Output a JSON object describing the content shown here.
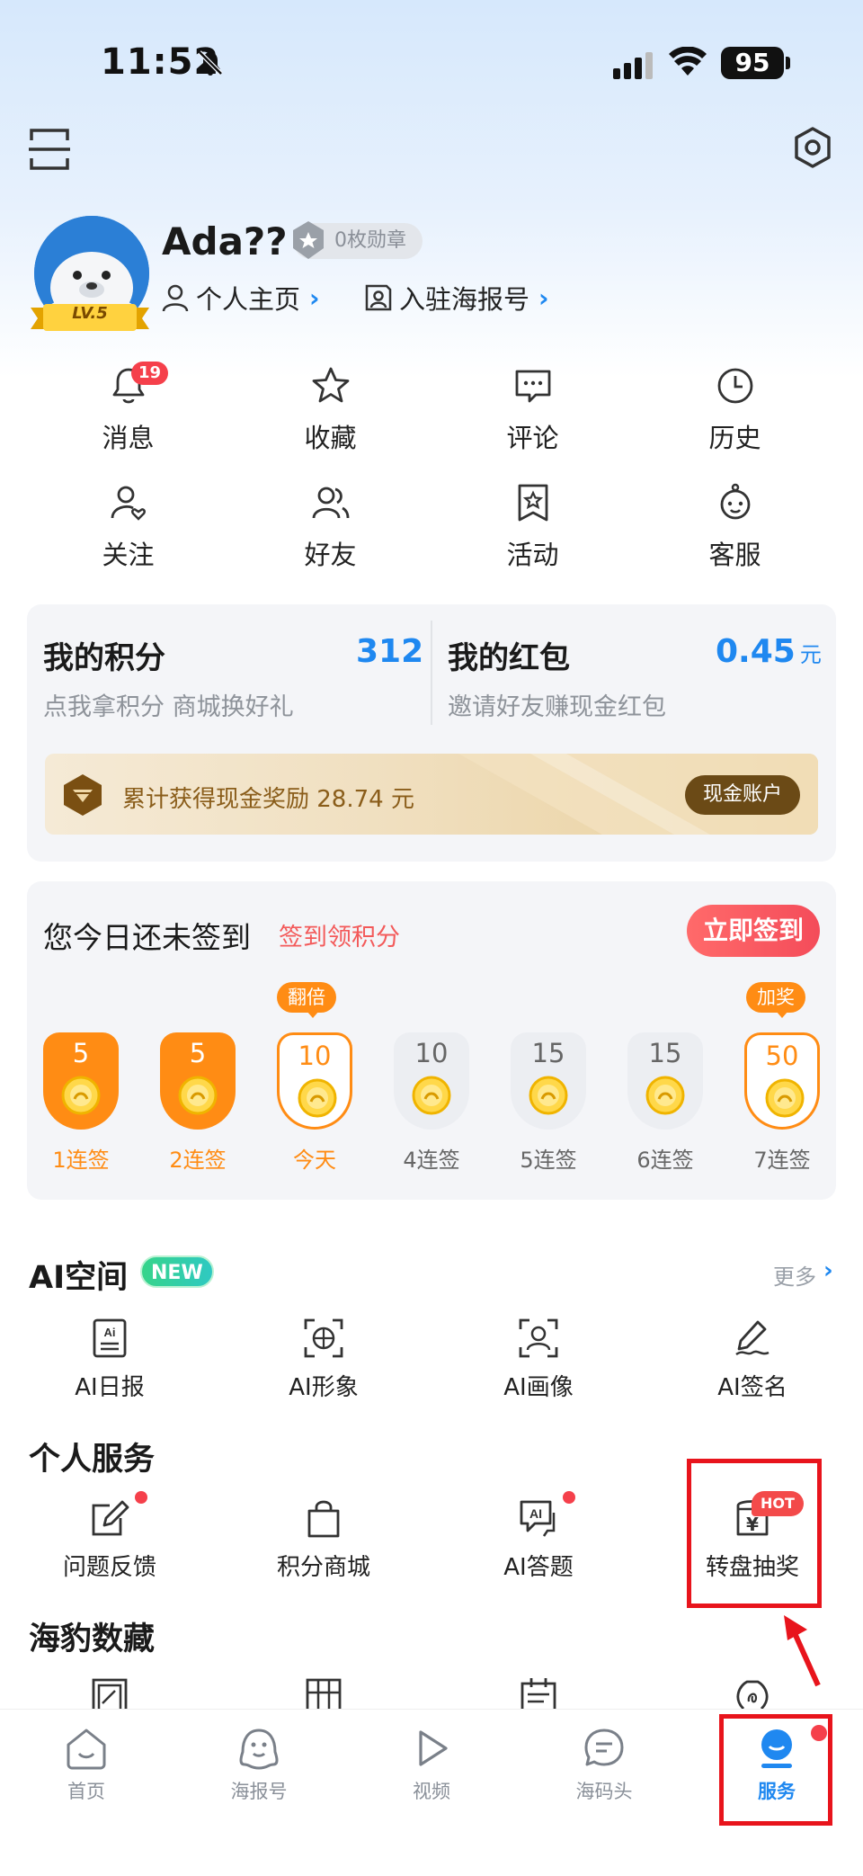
{
  "status_bar": {
    "time": "11:52",
    "battery": "95"
  },
  "profile": {
    "username": "Ada??",
    "level": "LV.5",
    "medals": "0枚勋章",
    "home_link": "个人主页",
    "haibao_link": "入驻海报号"
  },
  "quick_actions": [
    {
      "label": "消息",
      "icon": "bell-icon",
      "badge": "19"
    },
    {
      "label": "收藏",
      "icon": "star-icon"
    },
    {
      "label": "评论",
      "icon": "comment-icon"
    },
    {
      "label": "历史",
      "icon": "clock-icon"
    },
    {
      "label": "关注",
      "icon": "follow-icon"
    },
    {
      "label": "好友",
      "icon": "friends-icon"
    },
    {
      "label": "活动",
      "icon": "activity-icon"
    },
    {
      "label": "客服",
      "icon": "service-icon"
    }
  ],
  "points": {
    "title": "我的积分",
    "value": "312",
    "subtitle": "点我拿积分 商城换好礼"
  },
  "redpacket": {
    "title": "我的红包",
    "value": "0.45",
    "unit": "元",
    "subtitle": "邀请好友赚现金红包"
  },
  "cash": {
    "text": "累计获得现金奖励 28.74 元",
    "button": "现金账户"
  },
  "signin": {
    "title": "您今日还未签到",
    "subtitle": "签到领积分",
    "button": "立即签到",
    "days": [
      {
        "points": "5",
        "label": "1连签",
        "state": "done"
      },
      {
        "points": "5",
        "label": "2连签",
        "state": "done"
      },
      {
        "points": "10",
        "label": "今天",
        "state": "today",
        "tag": "翻倍"
      },
      {
        "points": "10",
        "label": "4连签",
        "state": "future"
      },
      {
        "points": "15",
        "label": "5连签",
        "state": "future"
      },
      {
        "points": "15",
        "label": "6连签",
        "state": "future"
      },
      {
        "points": "50",
        "label": "7连签",
        "state": "bonus",
        "tag": "加奖"
      }
    ]
  },
  "ai_space": {
    "title": "AI空间",
    "badge": "NEW",
    "more": "更多",
    "items": [
      {
        "label": "AI日报",
        "icon": "ai-daily-icon"
      },
      {
        "label": "AI形象",
        "icon": "ai-avatar-icon"
      },
      {
        "label": "AI画像",
        "icon": "ai-portrait-icon"
      },
      {
        "label": "AI签名",
        "icon": "ai-signature-icon"
      }
    ]
  },
  "personal_services": {
    "title": "个人服务",
    "items": [
      {
        "label": "问题反馈",
        "icon": "feedback-icon",
        "dot": true
      },
      {
        "label": "积分商城",
        "icon": "shopping-bag-icon"
      },
      {
        "label": "AI答题",
        "icon": "ai-quiz-icon",
        "dot": true
      },
      {
        "label": "转盘抽奖",
        "icon": "lottery-icon",
        "badge": "HOT"
      }
    ]
  },
  "collectibles": {
    "title": "海豹数藏"
  },
  "bottom_nav": [
    {
      "label": "首页",
      "icon": "home-icon"
    },
    {
      "label": "海报号",
      "icon": "seal-icon"
    },
    {
      "label": "视频",
      "icon": "play-icon"
    },
    {
      "label": "海码头",
      "icon": "chat-icon"
    },
    {
      "label": "服务",
      "icon": "service-tab-icon",
      "active": true
    }
  ],
  "colors": {
    "accent": "#1f88f0",
    "orange": "#ff8c14",
    "red": "#f5404b",
    "highlight_box": "#e8141c"
  }
}
